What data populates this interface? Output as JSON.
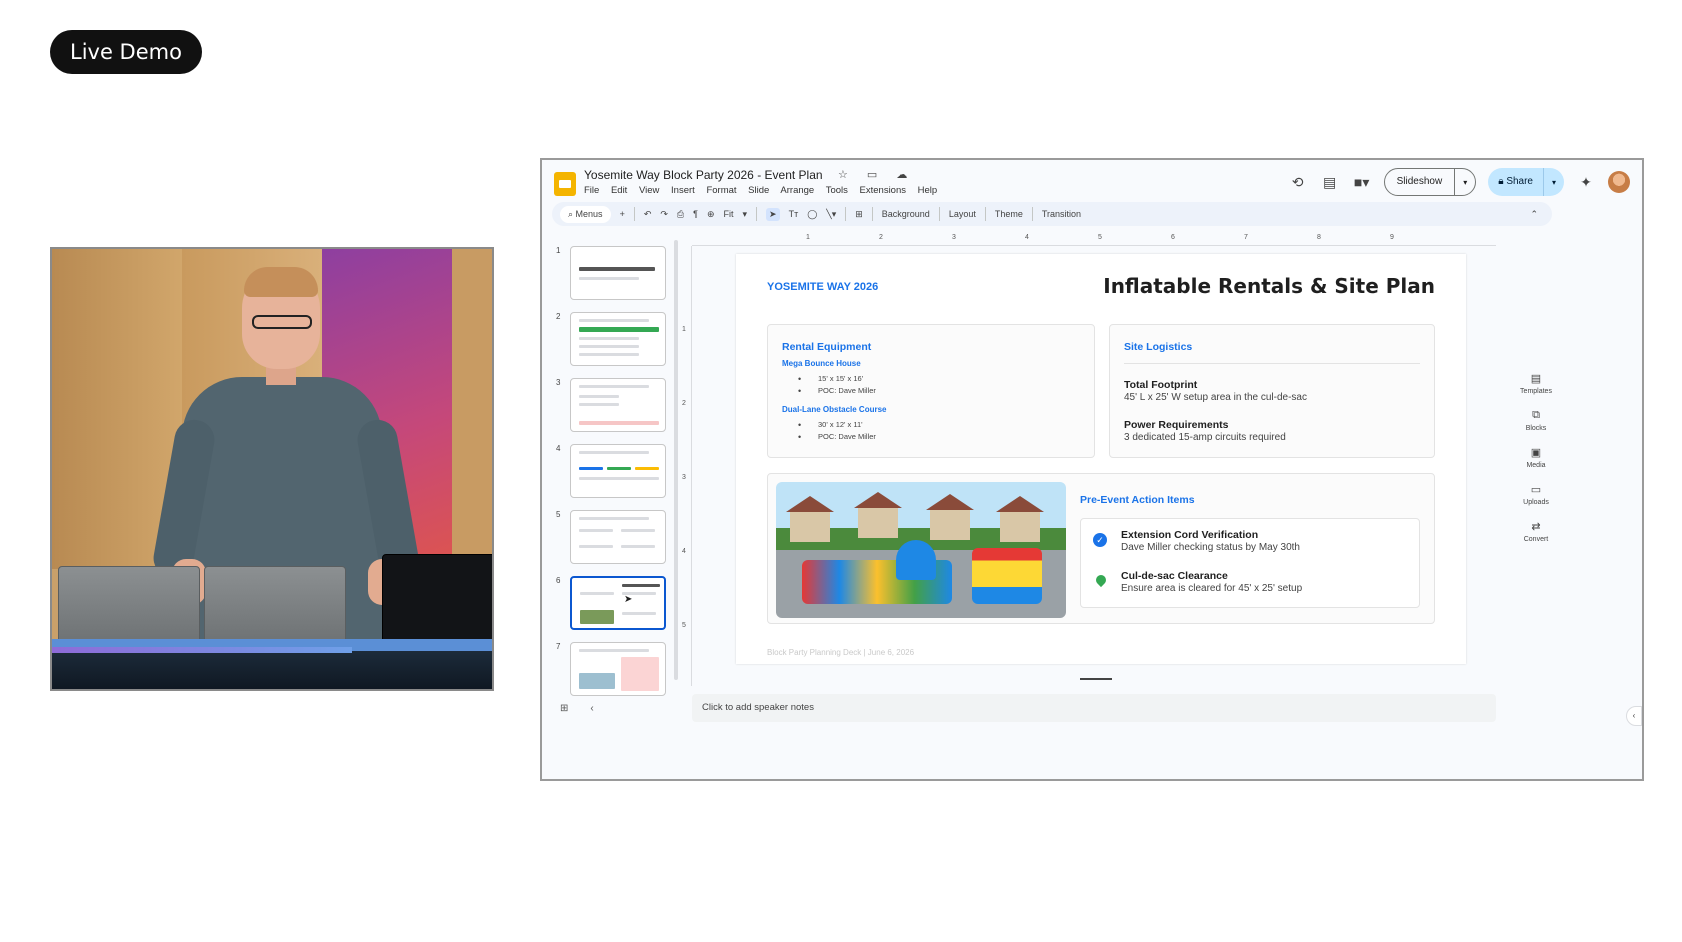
{
  "overlay": {
    "badge": "Live Demo"
  },
  "video": {
    "description_icon": "presenter-video"
  },
  "app": {
    "title": "Yosemite Way Block Party 2026 - Event Plan",
    "title_icons": "☆ ▭ ☁",
    "menus": [
      "File",
      "Edit",
      "View",
      "Insert",
      "Format",
      "Slide",
      "Arrange",
      "Tools",
      "Extensions",
      "Help"
    ],
    "slideshow_label": "Slideshow",
    "share_label": "Share",
    "toolbar": {
      "search": "Menus",
      "zoom": "Fit",
      "background": "Background",
      "layout": "Layout",
      "theme": "Theme",
      "transition": "Transition"
    },
    "ruler_h": [
      "1",
      "2",
      "3",
      "4",
      "5",
      "6",
      "7",
      "8",
      "9"
    ],
    "ruler_v": [
      "1",
      "2",
      "3",
      "4",
      "5"
    ],
    "thumbnails": [
      {
        "num": "1"
      },
      {
        "num": "2"
      },
      {
        "num": "3"
      },
      {
        "num": "4"
      },
      {
        "num": "5"
      },
      {
        "num": "6"
      },
      {
        "num": "7"
      }
    ],
    "notes_placeholder": "Click to add speaker notes",
    "side_panel": [
      "Templates",
      "Blocks",
      "Media",
      "Uploads",
      "Convert"
    ]
  },
  "slide": {
    "brand": "YOSEMITE WAY 2026",
    "title": "Inflatable Rentals & Site Plan",
    "rental": {
      "heading": "Rental Equipment",
      "item1": {
        "name": "Mega Bounce House",
        "size": "15' x 15' x 16'",
        "poc": "POC: Dave Miller"
      },
      "item2": {
        "name": "Dual-Lane Obstacle Course",
        "size": "30' x 12' x 11'",
        "poc": "POC: Dave Miller"
      }
    },
    "logistics": {
      "heading": "Site Logistics",
      "footprint_h": "Total Footprint",
      "footprint_t": "45' L x 25' W setup area in the cul-de-sac",
      "power_h": "Power Requirements",
      "power_t": "3 dedicated 15-amp circuits required"
    },
    "actions": {
      "heading": "Pre-Event Action Items",
      "a1_h": "Extension Cord Verification",
      "a1_t": "Dave Miller checking status by May 30th",
      "a2_h": "Cul-de-sac Clearance",
      "a2_t": "Ensure area is cleared for 45' x 25' setup"
    },
    "footer": "Block Party Planning Deck | June 6, 2026"
  },
  "colors": {
    "accent": "#1a73e8",
    "share_bg": "#c2e7ff",
    "selected_thumb": "#0b57d0"
  }
}
